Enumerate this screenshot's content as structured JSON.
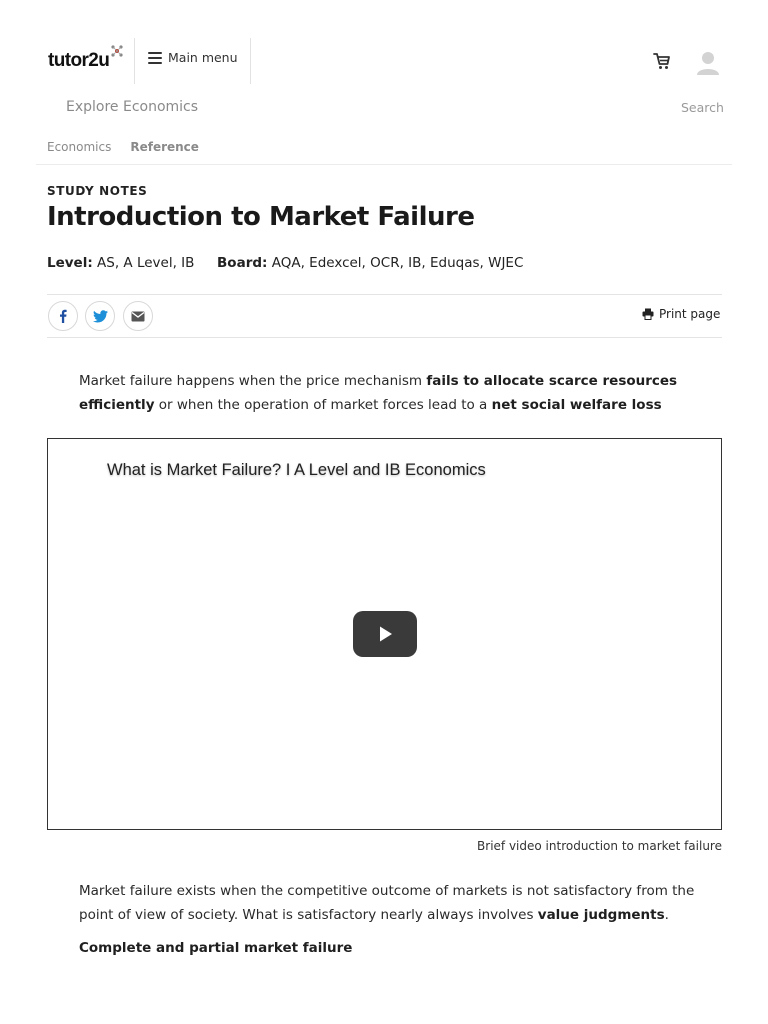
{
  "header": {
    "logo": "tutor2u",
    "main_menu_label": "Main menu"
  },
  "subnav": {
    "explore": "Explore Economics",
    "search": "Search"
  },
  "breadcrumb": [
    "Economics",
    "Reference"
  ],
  "article": {
    "kicker": "STUDY NOTES",
    "title": "Introduction to Market Failure",
    "level_label": "Level:",
    "level_value": "AS, A Level, IB",
    "board_label": "Board:",
    "board_value": "AQA, Edexcel, OCR, IB, Eduqas, WJEC"
  },
  "share": {
    "print_label": "Print page"
  },
  "intro": {
    "t1": "Market failure happens when the price mechanism ",
    "b1": "fails to allocate scarce resources efficiently",
    "t2": " or when the operation of market forces lead to a ",
    "b2": "net social welfare loss"
  },
  "video": {
    "title": "What is Market Failure? I A Level and IB Economics",
    "caption": "Brief video introduction to market failure"
  },
  "body": {
    "t1": "Market failure exists when the competitive outcome of markets is not satisfactory from the point of view of society. What is satisfactory nearly always involves ",
    "b1": "value judgments",
    "t2": ".",
    "subheading": "Complete and partial market failure"
  },
  "colors": {
    "text": "#222222",
    "muted": "#8a8a8a",
    "divider": "#e4e4e4",
    "play_button": "#3a3a3a"
  },
  "icons": [
    "menu-icon",
    "cart-icon",
    "user-icon",
    "facebook-icon",
    "twitter-icon",
    "email-icon",
    "printer-icon",
    "play-icon"
  ]
}
